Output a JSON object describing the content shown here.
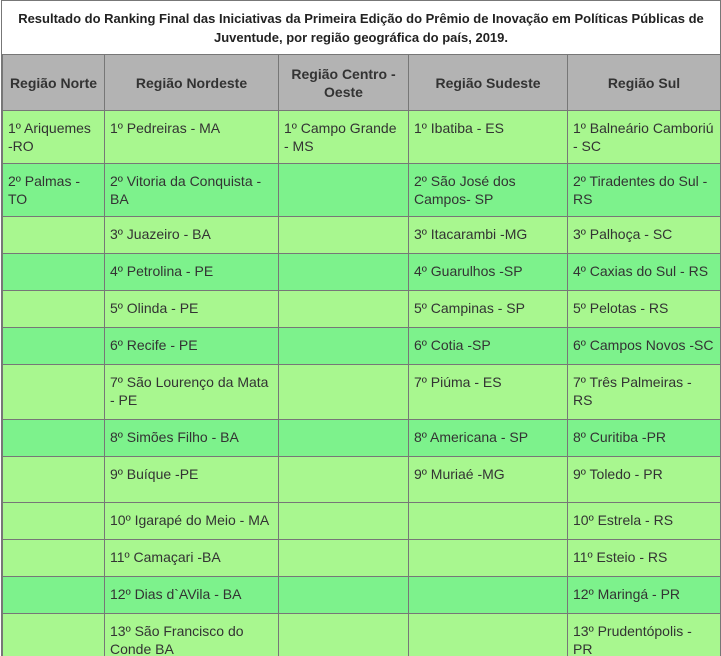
{
  "caption": {
    "line1": "Resultado  do Ranking Final das Iniciativas da Primeira Edição do Prêmio de Inovação em Políticas Públicas de",
    "line2": "Juventude, por região geográfica do país, 2019."
  },
  "headers": [
    "Região Norte",
    "Região Nordeste",
    "Região Centro - Oeste",
    "Região Sudeste",
    "Região Sul"
  ],
  "rows": [
    [
      "1º Ariquemes -RO",
      "1º Pedreiras - MA",
      "1º Campo Grande  - MS",
      "1º Ibatiba - ES",
      "1º  Balneário Camboriú - SC"
    ],
    [
      "2º Palmas -TO",
      "2º Vitoria da Conquista - BA",
      "",
      "2º São José dos Campos- SP",
      "2º Tiradentes do Sul -RS"
    ],
    [
      "",
      "3º  Juazeiro - BA",
      "",
      "3º Itacarambi -MG",
      "3º Palhoça - SC"
    ],
    [
      "",
      "4º  Petrolina - PE",
      "",
      "4º Guarulhos -SP",
      "4º Caxias do Sul - RS"
    ],
    [
      "",
      "5º  Olinda - PE",
      "",
      "5º  Campinas - SP",
      "5º Pelotas - RS"
    ],
    [
      "",
      "6º  Recife - PE",
      "",
      "6º  Cotia -SP",
      "6º Campos Novos -SC"
    ],
    [
      "",
      "7º São Lourenço da Mata  - PE",
      "",
      "7º Piúma - ES",
      "7º Três Palmeiras - RS"
    ],
    [
      "",
      "8º  Simões Filho - BA",
      "",
      "8º Americana - SP",
      "8º Curitiba -PR"
    ],
    [
      "",
      "9º  Buíque -PE",
      "",
      "9º  Muriaé -MG",
      "9º Toledo - PR"
    ],
    [
      "",
      "10º  Igarapé do Meio - MA",
      "",
      "",
      "10º  Estrela - RS"
    ],
    [
      "",
      "11º Camaçari -BA",
      "",
      "",
      "11º Esteio - RS"
    ],
    [
      "",
      "12º  Dias d`AVila - BA",
      "",
      "",
      "12º Maringá - PR"
    ],
    [
      "",
      "13º São Francisco do Conde  BA",
      "",
      "",
      "13º Prudentópolis - PR"
    ]
  ],
  "colors": {
    "header_bg": "#b3b3b3",
    "row_light": "#a8f78f",
    "row_mid": "#7df28c",
    "border": "#777777"
  }
}
